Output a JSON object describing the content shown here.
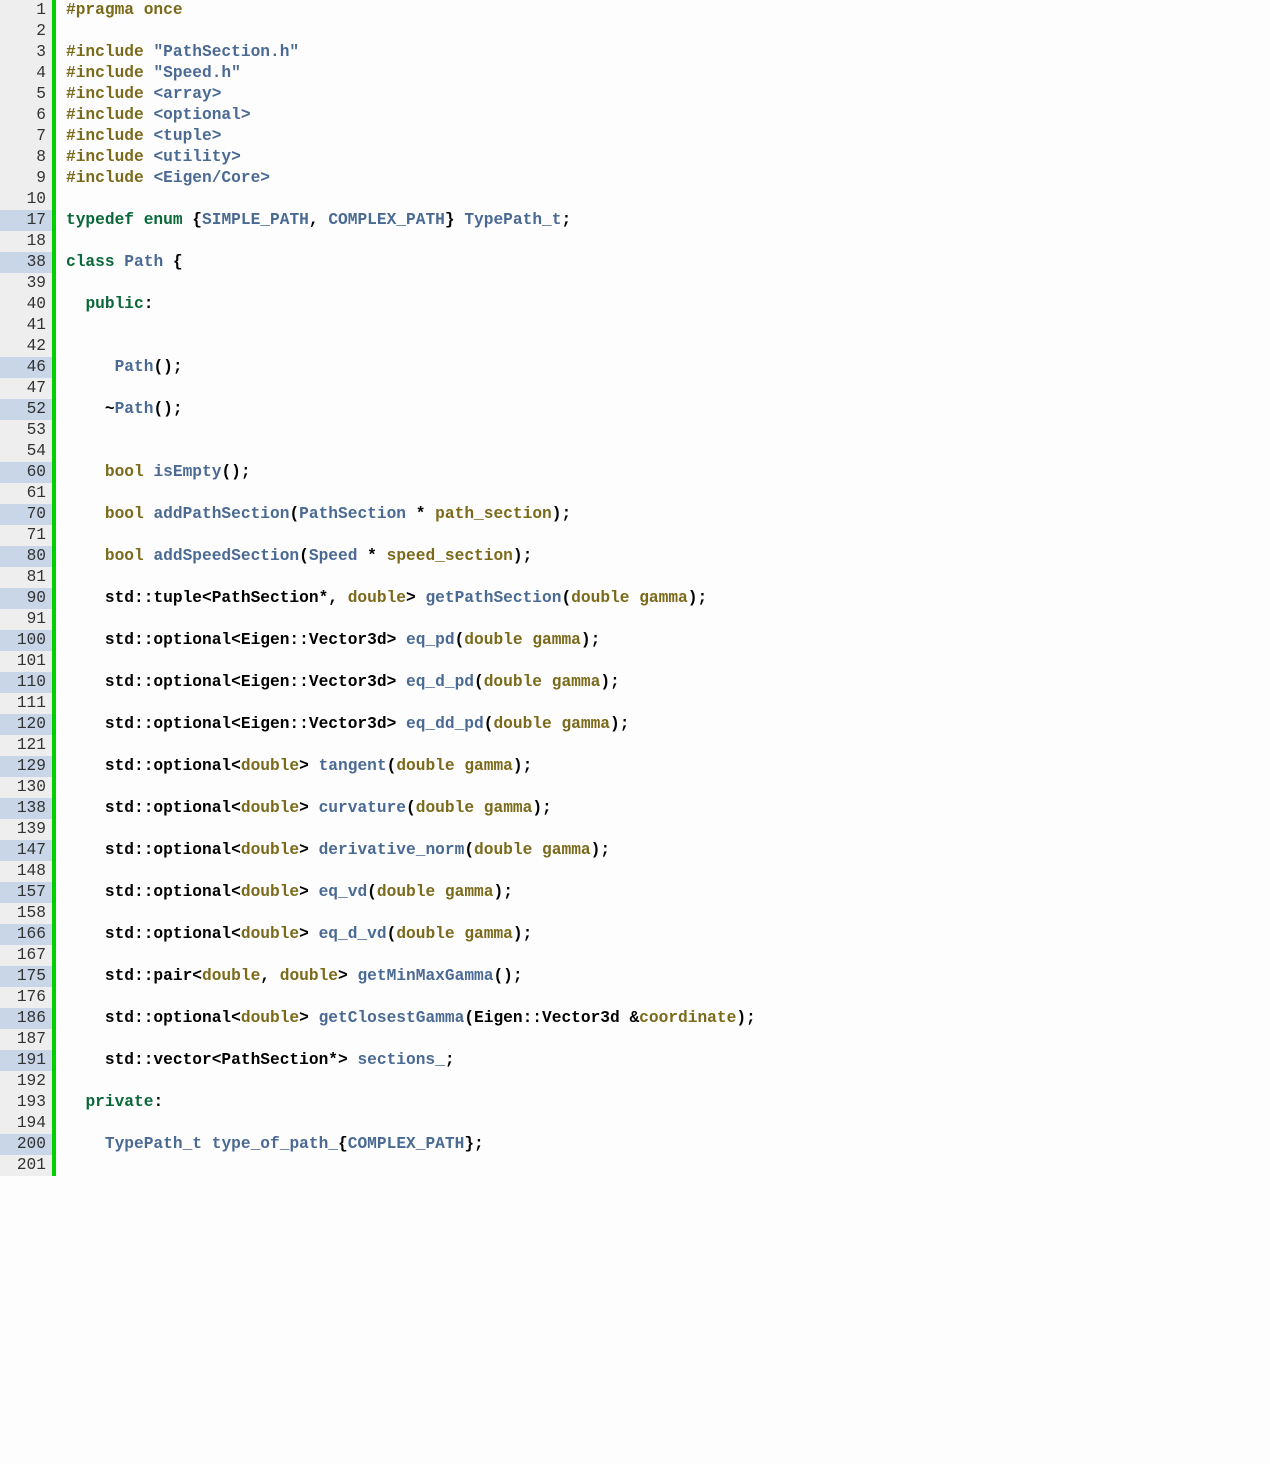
{
  "lines": [
    {
      "n": "1",
      "hl": false,
      "html": "<span class='pp'>#pragma once</span>"
    },
    {
      "n": "2",
      "hl": false,
      "html": ""
    },
    {
      "n": "3",
      "hl": false,
      "html": "<span class='pp'>#include </span><span class='str'>\"PathSection.h\"</span>"
    },
    {
      "n": "4",
      "hl": false,
      "html": "<span class='pp'>#include </span><span class='str'>\"Speed.h\"</span>"
    },
    {
      "n": "5",
      "hl": false,
      "html": "<span class='pp'>#include </span><span class='str'>&lt;array&gt;</span>"
    },
    {
      "n": "6",
      "hl": false,
      "html": "<span class='pp'>#include </span><span class='str'>&lt;optional&gt;</span>"
    },
    {
      "n": "7",
      "hl": false,
      "html": "<span class='pp'>#include </span><span class='str'>&lt;tuple&gt;</span>"
    },
    {
      "n": "8",
      "hl": false,
      "html": "<span class='pp'>#include </span><span class='str'>&lt;utility&gt;</span>"
    },
    {
      "n": "9",
      "hl": false,
      "html": "<span class='pp'>#include </span><span class='str'>&lt;Eigen/Core&gt;</span>"
    },
    {
      "n": "10",
      "hl": false,
      "html": ""
    },
    {
      "n": "17",
      "hl": true,
      "html": "<span class='kw'>typedef</span> <span class='kw'>enum</span> {<span class='name'>SIMPLE_PATH</span>, <span class='name'>COMPLEX_PATH</span>} <span class='name'>TypePath_t</span>;"
    },
    {
      "n": "18",
      "hl": false,
      "html": ""
    },
    {
      "n": "38",
      "hl": true,
      "html": "<span class='kw'>class </span><span class='name'>Path</span> {"
    },
    {
      "n": "39",
      "hl": false,
      "html": ""
    },
    {
      "n": "40",
      "hl": false,
      "html": "  <span class='kw'>public</span>:"
    },
    {
      "n": "41",
      "hl": false,
      "html": ""
    },
    {
      "n": "42",
      "hl": false,
      "html": ""
    },
    {
      "n": "46",
      "hl": true,
      "html": "     <span class='name'>Path</span>();"
    },
    {
      "n": "47",
      "hl": false,
      "html": ""
    },
    {
      "n": "52",
      "hl": true,
      "html": "    ~<span class='name'>Path</span>();"
    },
    {
      "n": "53",
      "hl": false,
      "html": ""
    },
    {
      "n": "54",
      "hl": false,
      "html": ""
    },
    {
      "n": "60",
      "hl": true,
      "html": "    <span class='br'>bool</span> <span class='name'>isEmpty</span>();"
    },
    {
      "n": "61",
      "hl": false,
      "html": ""
    },
    {
      "n": "70",
      "hl": true,
      "html": "    <span class='br'>bool</span> <span class='name'>addPathSection</span>(<span class='name'>PathSection</span> * <span class='br'>path_section</span>);"
    },
    {
      "n": "71",
      "hl": false,
      "html": ""
    },
    {
      "n": "80",
      "hl": true,
      "html": "    <span class='br'>bool</span> <span class='name'>addSpeedSection</span>(<span class='name'>Speed</span> * <span class='br'>speed_section</span>);"
    },
    {
      "n": "81",
      "hl": false,
      "html": ""
    },
    {
      "n": "90",
      "hl": true,
      "html": "    std::tuple&lt;PathSection*, <span class='br'>double</span>&gt; <span class='name'>getPathSection</span>(<span class='br'>double</span> <span class='br'>gamma</span>);"
    },
    {
      "n": "91",
      "hl": false,
      "html": ""
    },
    {
      "n": "100",
      "hl": true,
      "html": "    std::optional&lt;Eigen::Vector3d&gt; <span class='name'>eq_pd</span>(<span class='br'>double</span> <span class='br'>gamma</span>);"
    },
    {
      "n": "101",
      "hl": false,
      "html": ""
    },
    {
      "n": "110",
      "hl": true,
      "html": "    std::optional&lt;Eigen::Vector3d&gt; <span class='name'>eq_d_pd</span>(<span class='br'>double</span> <span class='br'>gamma</span>);"
    },
    {
      "n": "111",
      "hl": false,
      "html": ""
    },
    {
      "n": "120",
      "hl": true,
      "html": "    std::optional&lt;Eigen::Vector3d&gt; <span class='name'>eq_dd_pd</span>(<span class='br'>double</span> <span class='br'>gamma</span>);"
    },
    {
      "n": "121",
      "hl": false,
      "html": ""
    },
    {
      "n": "129",
      "hl": true,
      "html": "    std::optional&lt;<span class='br'>double</span>&gt; <span class='name'>tangent</span>(<span class='br'>double</span> <span class='br'>gamma</span>);"
    },
    {
      "n": "130",
      "hl": false,
      "html": ""
    },
    {
      "n": "138",
      "hl": true,
      "html": "    std::optional&lt;<span class='br'>double</span>&gt; <span class='name'>curvature</span>(<span class='br'>double</span> <span class='br'>gamma</span>);"
    },
    {
      "n": "139",
      "hl": false,
      "html": ""
    },
    {
      "n": "147",
      "hl": true,
      "html": "    std::optional&lt;<span class='br'>double</span>&gt; <span class='name'>derivative_norm</span>(<span class='br'>double</span> <span class='br'>gamma</span>);"
    },
    {
      "n": "148",
      "hl": false,
      "html": ""
    },
    {
      "n": "157",
      "hl": true,
      "html": "    std::optional&lt;<span class='br'>double</span>&gt; <span class='name'>eq_vd</span>(<span class='br'>double</span> <span class='br'>gamma</span>);"
    },
    {
      "n": "158",
      "hl": false,
      "html": ""
    },
    {
      "n": "166",
      "hl": true,
      "html": "    std::optional&lt;<span class='br'>double</span>&gt; <span class='name'>eq_d_vd</span>(<span class='br'>double</span> <span class='br'>gamma</span>);"
    },
    {
      "n": "167",
      "hl": false,
      "html": ""
    },
    {
      "n": "175",
      "hl": true,
      "html": "    std::pair&lt;<span class='br'>double</span>, <span class='br'>double</span>&gt; <span class='name'>getMinMaxGamma</span>();"
    },
    {
      "n": "176",
      "hl": false,
      "html": ""
    },
    {
      "n": "186",
      "hl": true,
      "html": "    std::optional&lt;<span class='br'>double</span>&gt; <span class='name'>getClosestGamma</span>(Eigen::Vector3d &amp;<span class='br'>coordinate</span>);"
    },
    {
      "n": "187",
      "hl": false,
      "html": ""
    },
    {
      "n": "191",
      "hl": true,
      "html": "    std::vector&lt;PathSection*&gt; <span class='name'>sections_</span>;"
    },
    {
      "n": "192",
      "hl": false,
      "html": ""
    },
    {
      "n": "193",
      "hl": false,
      "html": "  <span class='kw'>private</span>:"
    },
    {
      "n": "194",
      "hl": false,
      "html": ""
    },
    {
      "n": "200",
      "hl": true,
      "html": "    <span class='name'>TypePath_t</span> <span class='name'>type_of_path_</span>{<span class='name'>COMPLEX_PATH</span>};"
    },
    {
      "n": "201",
      "hl": false,
      "html": ""
    }
  ]
}
